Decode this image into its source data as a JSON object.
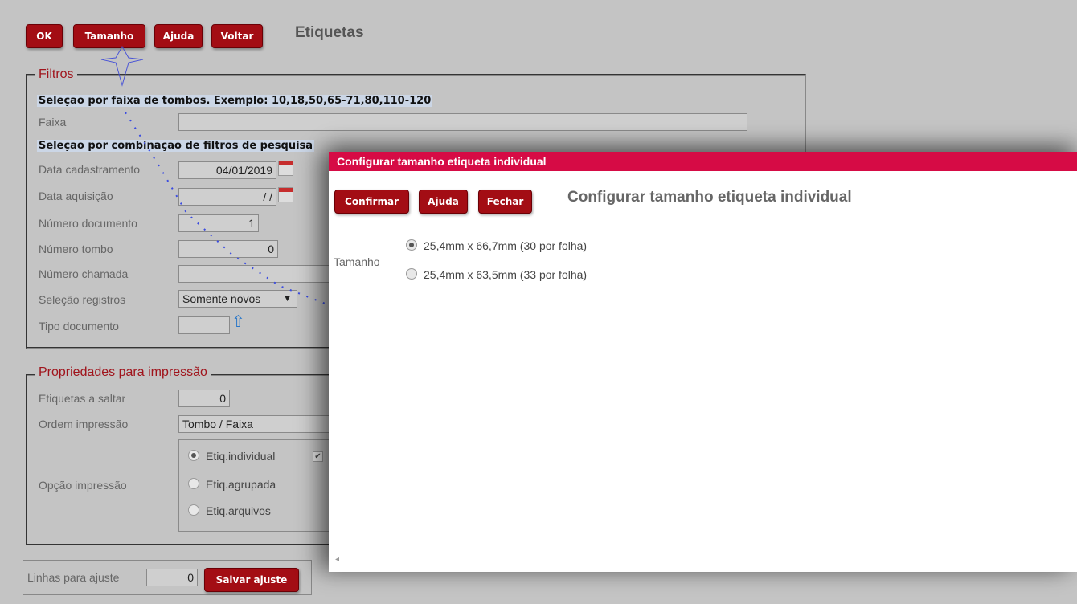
{
  "toolbar": {
    "ok": "OK",
    "tamanho": "Tamanho",
    "ajuda": "Ajuda",
    "voltar": "Voltar"
  },
  "page_title": "Etiquetas",
  "filtros": {
    "legend": "Filtros",
    "range_header": "Seleção por faixa de tombos. Exemplo: 10,18,50,65-71,80,110-120",
    "faixa_label": "Faixa",
    "faixa_value": "",
    "combo_header": "Seleção por combinação de filtros de pesquisa",
    "data_cadastramento_label": "Data cadastramento",
    "data_cadastramento_value": "04/01/2019",
    "data_aquisicao_label": "Data aquisição",
    "data_aquisicao_value": "/ /",
    "numero_documento_label": "Número documento",
    "numero_documento_value": "1",
    "numero_tombo_label": "Número tombo",
    "numero_tombo_value": "0",
    "numero_chamada_label": "Número chamada",
    "numero_chamada_value": "",
    "selecao_registros_label": "Seleção registros",
    "selecao_registros_value": "Somente novos",
    "tipo_documento_label": "Tipo documento",
    "tipo_documento_value": ""
  },
  "propriedades": {
    "legend": "Propriedades para impressão",
    "etiquetas_saltar_label": "Etiquetas a saltar",
    "etiquetas_saltar_value": "0",
    "ordem_label": "Ordem impressão",
    "ordem_value": "Tombo / Faixa",
    "opcao_label": "Opção impressão",
    "opcoes": [
      "Etiq.individual",
      "Etiq.agrupada",
      "Etiq.arquivos"
    ],
    "opcao_selected": "Etiq.individual"
  },
  "ajuste": {
    "label": "Linhas para ajuste",
    "value": "0",
    "button": "Salvar ajuste"
  },
  "dialog": {
    "title": "Configurar tamanho etiqueta individual",
    "buttons": {
      "confirmar": "Confirmar",
      "ajuda": "Ajuda",
      "fechar": "Fechar"
    },
    "heading": "Configurar tamanho etiqueta individual",
    "tamanho_label": "Tamanho",
    "options": [
      "25,4mm x 66,7mm (30 por folha)",
      "25,4mm x 63,5mm (33 por folha)"
    ],
    "selected": "25,4mm x 66,7mm (30 por folha)"
  },
  "colors": {
    "button": "#a30d14",
    "titlebar": "#d60b45",
    "legend": "#a0141c",
    "background": "#c4c4c4"
  }
}
